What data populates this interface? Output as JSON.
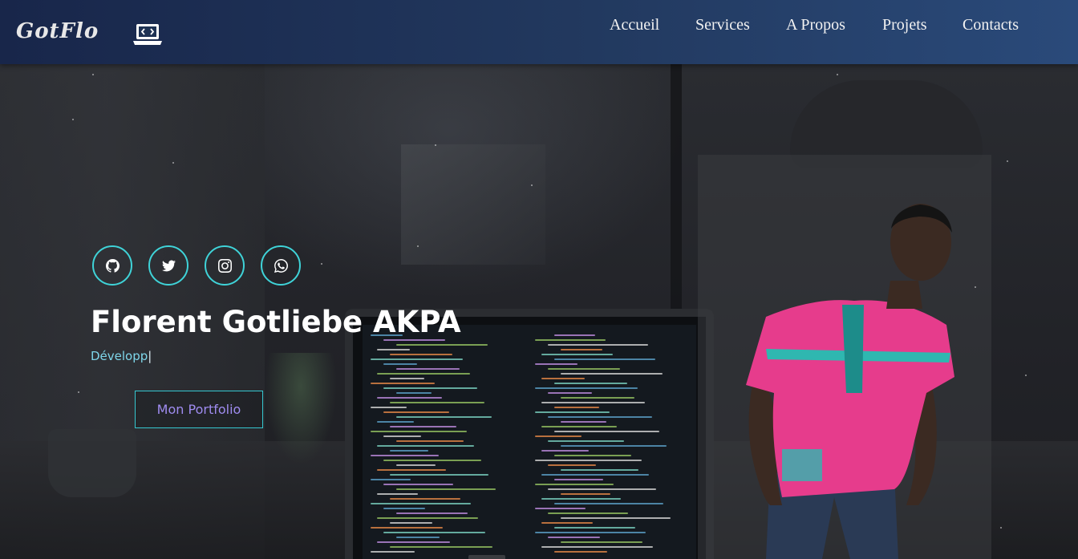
{
  "navbar": {
    "brand": "GotFlo",
    "brand_icon": "laptop-code-icon",
    "links": [
      {
        "label": "Accueil"
      },
      {
        "label": "Services"
      },
      {
        "label": "A Propos"
      },
      {
        "label": "Projets"
      },
      {
        "label": "Contacts"
      }
    ]
  },
  "hero": {
    "social": [
      {
        "icon": "github-icon"
      },
      {
        "icon": "twitter-icon"
      },
      {
        "icon": "instagram-icon"
      },
      {
        "icon": "whatsapp-icon"
      }
    ],
    "name": "Florent Gotliebe AKPA",
    "role_typed": "Développ",
    "cursor": "|",
    "cta_label": "Mon Portfolio"
  },
  "colors": {
    "accent_cyan": "#3fd3d8",
    "cta_text": "#9f8cf0",
    "role_text": "#7ed6ea"
  }
}
